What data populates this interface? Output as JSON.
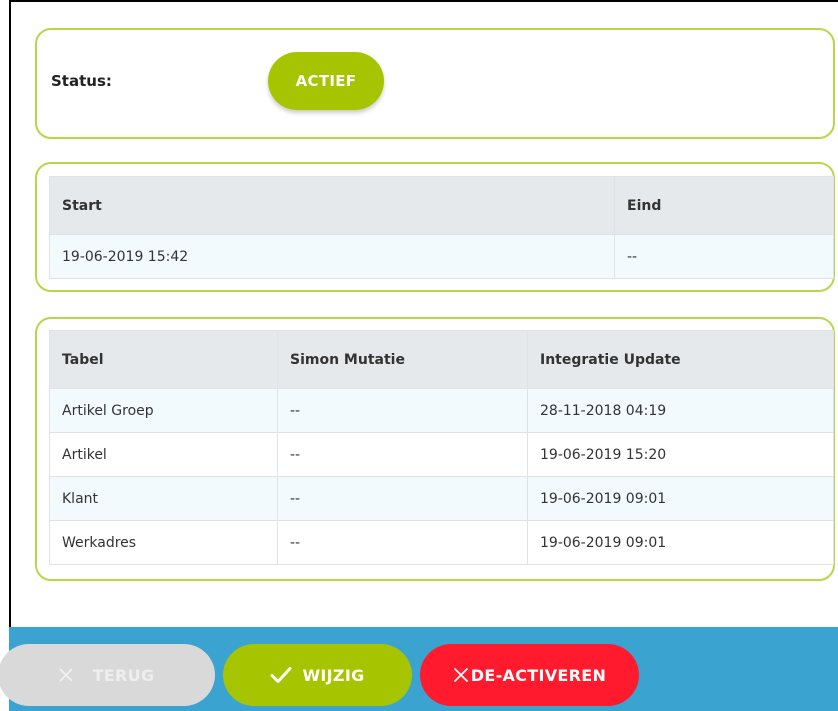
{
  "status": {
    "label": "Status:",
    "value": "ACTIEF"
  },
  "period": {
    "headers": [
      "Start",
      "Eind"
    ],
    "rows": [
      [
        "19-06-2019 15:42",
        "--"
      ]
    ]
  },
  "tables": {
    "headers": [
      "Tabel",
      "Simon Mutatie",
      "Integratie Update"
    ],
    "rows": [
      [
        "Artikel Groep",
        "--",
        "28-11-2018 04:19"
      ],
      [
        "Artikel",
        "--",
        "19-06-2019 15:20"
      ],
      [
        "Klant",
        "--",
        "19-06-2019 09:01"
      ],
      [
        "Werkadres",
        "--",
        "19-06-2019 09:01"
      ]
    ]
  },
  "actions": {
    "back_label": "TERUG",
    "edit_label": "WIJZIG",
    "deactivate_label": "DE-ACTIVEREN"
  },
  "colors": {
    "accent_green": "#a6c500",
    "card_border": "#b8d64a",
    "bar_blue": "#3ba3d0",
    "danger_red": "#ff1a2e",
    "disabled_grey": "#d9d9d9"
  },
  "icons": {
    "back": "close-icon",
    "edit": "checkmark-icon",
    "deactivate": "close-icon"
  }
}
